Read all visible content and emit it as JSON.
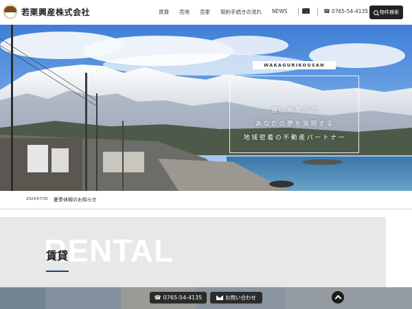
{
  "header": {
    "logo_text": "若栗興産株式会社",
    "nav": [
      "賃貸",
      "売地",
      "売家",
      "契約手続きの流れ",
      "NEWS"
    ],
    "tel": "0765-54-4135",
    "tel_icon": "☎",
    "search_label": "物件検索"
  },
  "hero": {
    "tag": "WAKAGURIKOUSAN",
    "line1": "富山県黒部市",
    "line2": "あなたの夢を実現する",
    "line3": "地域密着の不動産パートナー"
  },
  "news": {
    "date": "2024/07/30",
    "title": "夏季休暇のお知らせ"
  },
  "rental": {
    "bg_word": "RENTAL",
    "title": "賃貸"
  },
  "bottom_bar": {
    "tel": "0765-54-4135",
    "tel_icon": "☎",
    "contact_label": "お問い合わせ"
  },
  "colors": {
    "accent": "#1f3f78",
    "dark_button": "#222222"
  },
  "icons": {
    "logo": "house-logo-icon",
    "mail": "mail-icon",
    "phone": "phone-icon",
    "search": "search-icon",
    "to_top": "chevron-up-icon"
  }
}
